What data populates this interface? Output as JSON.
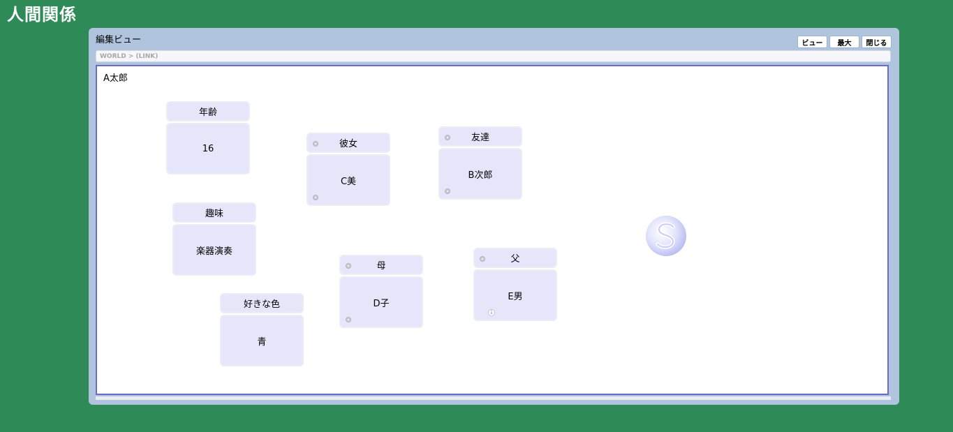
{
  "app": {
    "title": "人間関係"
  },
  "window": {
    "title": "編集ビュー",
    "buttons": {
      "view": "ビュー",
      "maximize": "最大",
      "close": "閉じる"
    },
    "breadcrumb": "WORLD > (LINK)"
  },
  "canvas": {
    "node_name": "A太郎",
    "cards": {
      "age": {
        "label": "年齢",
        "value": "16"
      },
      "girlfriend": {
        "label": "彼女",
        "value": "C美"
      },
      "friend": {
        "label": "友達",
        "value": "B次郎"
      },
      "hobby": {
        "label": "趣味",
        "value": "楽器演奏"
      },
      "mother": {
        "label": "母",
        "value": "D子"
      },
      "father": {
        "label": "父",
        "value": "E男"
      },
      "favorite_color": {
        "label": "好きな色",
        "value": "青"
      }
    }
  },
  "icons": {
    "link_dot": "link-dot-icon",
    "expand_down": "arrow-down-icon",
    "logo": "s-logo-icon"
  },
  "colors": {
    "background": "#2e8b57",
    "window": "#b0c4de",
    "card": "#e6e6fa",
    "canvas_border": "#6b6bc7"
  }
}
